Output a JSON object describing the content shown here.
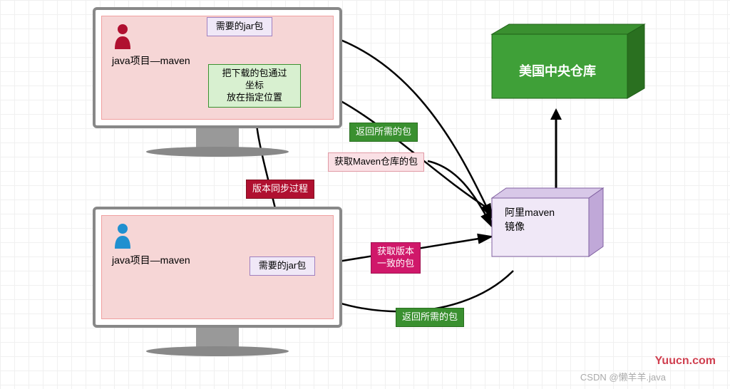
{
  "monitor_top": {
    "project_label": "java项目—maven",
    "jar_box": "需要的jar包",
    "download_box": "把下载的包通过\n坐标\n放在指定位置"
  },
  "monitor_bottom": {
    "project_label": "java项目—maven",
    "jar_box": "需要的jar包"
  },
  "labels": {
    "return_pkg_1": "返回所需的包",
    "return_pkg_2": "返回所需的包",
    "get_maven_repo": "获取Maven仓库的包",
    "version_sync": "版本同步过程",
    "get_consistent": "获取版本\n一致的包"
  },
  "ali_mirror": "阿里maven\n镜像",
  "us_central": "美国中央仓库",
  "watermark_site": "Yuucn.com",
  "watermark_author": "CSDN @懒羊羊.java"
}
